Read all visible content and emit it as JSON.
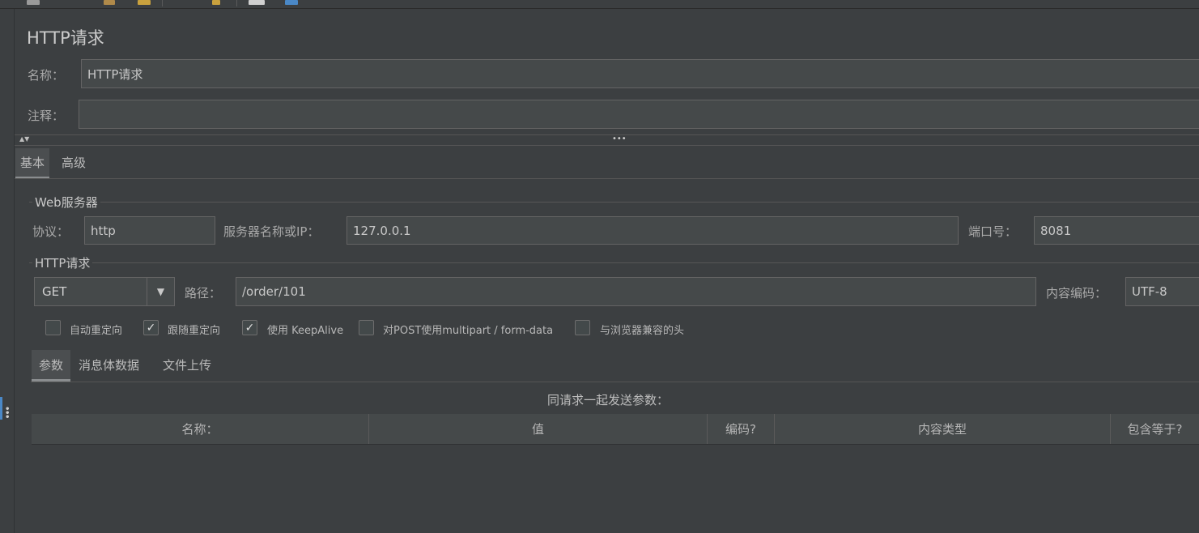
{
  "title": "HTTP请求",
  "name_label": "名称：",
  "name_value": "HTTP请求",
  "comment_label": "注释：",
  "comment_value": "",
  "collapse_arrows": "▲▼",
  "splitter_dots": "•••",
  "tabs": [
    {
      "label": "基本",
      "selected": true
    },
    {
      "label": "高级",
      "selected": false
    }
  ],
  "web_server": {
    "group_title": "Web服务器",
    "protocol_label": "协议：",
    "protocol_value": "http",
    "server_label": "服务器名称或IP：",
    "server_value": "127.0.0.1",
    "port_label": "端口号：",
    "port_value": "8081"
  },
  "http_request": {
    "group_title": "HTTP请求",
    "method": "GET",
    "path_label": "路径：",
    "path_value": "/order/101",
    "encoding_label": "内容编码：",
    "encoding_value": "UTF-8"
  },
  "checkboxes": [
    {
      "label": "自动重定向",
      "checked": false
    },
    {
      "label": "跟随重定向",
      "checked": true
    },
    {
      "label": "使用 KeepAlive",
      "checked": true
    },
    {
      "label": "对POST使用multipart / form-data",
      "checked": false
    },
    {
      "label": "与浏览器兼容的头",
      "checked": false
    }
  ],
  "check_mark": "✓",
  "sub_tabs": [
    {
      "label": "参数",
      "selected": true
    },
    {
      "label": "消息体数据",
      "selected": false
    },
    {
      "label": "文件上传",
      "selected": false
    }
  ],
  "params_caption": "同请求一起发送参数：",
  "table_headers": [
    "名称：",
    "值",
    "编码?",
    "内容类型",
    "包含等于?"
  ],
  "colors": {
    "background": "#3c3f41",
    "field": "#45494a",
    "border": "#646464",
    "accent": "#4a88c7"
  }
}
